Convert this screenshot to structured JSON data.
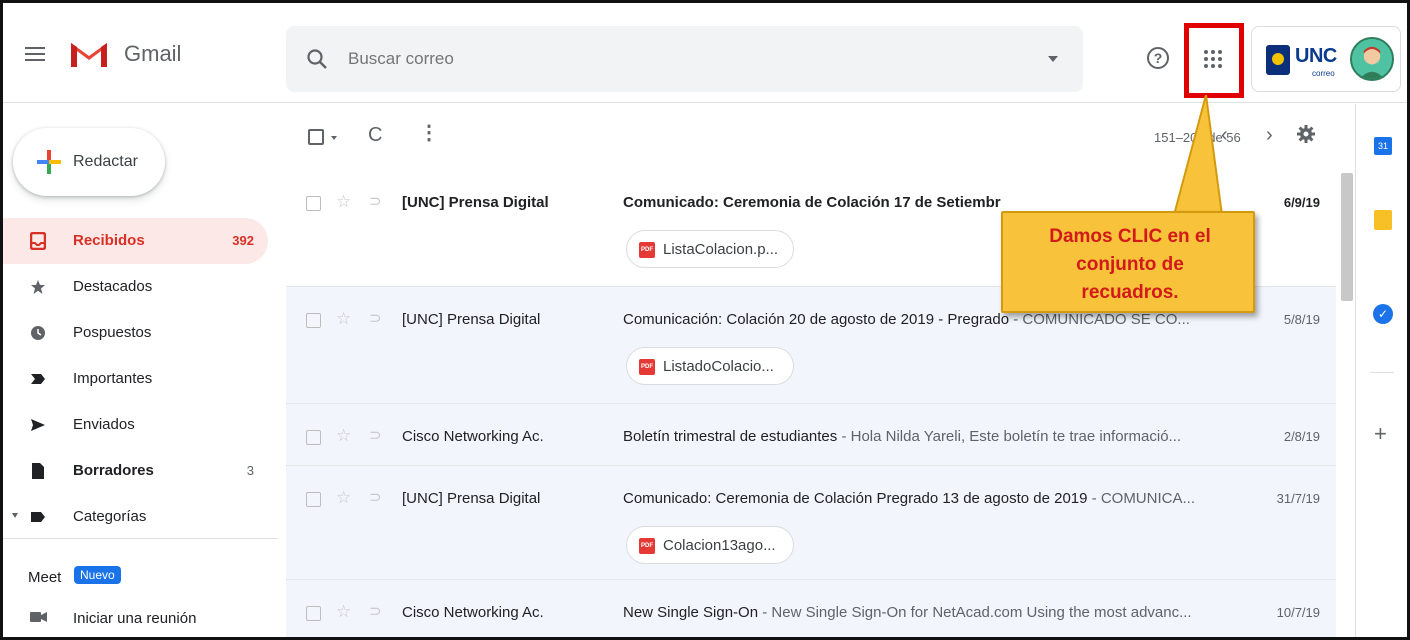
{
  "app": {
    "name": "Gmail"
  },
  "search": {
    "placeholder": "Buscar correo"
  },
  "header": {
    "help_icon": "help-icon",
    "apps_icon": "google-apps-grid-icon",
    "account_org": "UNC",
    "account_org_sub": "correo"
  },
  "compose": {
    "label": "Redactar"
  },
  "sidebar": {
    "items": [
      {
        "label": "Recibidos",
        "count": "392",
        "icon": "inbox-icon"
      },
      {
        "label": "Destacados",
        "count": "",
        "icon": "star-icon"
      },
      {
        "label": "Pospuestos",
        "count": "",
        "icon": "clock-icon"
      },
      {
        "label": "Importantes",
        "count": "",
        "icon": "important-icon"
      },
      {
        "label": "Enviados",
        "count": "",
        "icon": "send-icon"
      },
      {
        "label": "Borradores",
        "count": "3",
        "icon": "draft-icon"
      },
      {
        "label": "Categorías",
        "count": "",
        "icon": "label-icon"
      }
    ]
  },
  "meet": {
    "title": "Meet",
    "badge": "Nuevo",
    "item": "Iniciar una reunión"
  },
  "toolbar": {
    "range": "151–200 de 56",
    "refresh": "C",
    "more": "⋮",
    "prev": "‹",
    "next": "›"
  },
  "emails": [
    {
      "sender": "[UNC] Prensa Digital",
      "subject": "Comunicado: Ceremonia de Colación 17 de Setiembr",
      "snippet": "",
      "date": "6/9/19",
      "attachment": "ListaColacion.p...",
      "unread": true
    },
    {
      "sender": "[UNC] Prensa Digital",
      "subject": "Comunicación: Colación 20 de agosto de 2019 - Pregrado",
      "snippet": " - COMUNICADO SE CO...",
      "date": "5/8/19",
      "attachment": "ListadoColacio...",
      "unread": false
    },
    {
      "sender": "Cisco Networking Ac.",
      "subject": "Boletín trimestral de estudiantes",
      "snippet": " - Hola Nilda Yareli, Este boletín te trae informació...",
      "date": "2/8/19",
      "attachment": "",
      "unread": false
    },
    {
      "sender": "[UNC] Prensa Digital",
      "subject": "Comunicado: Ceremonia de Colación Pregrado 13 de agosto de 2019",
      "snippet": " - COMUNICA...",
      "date": "31/7/19",
      "attachment": "Colacion13ago...",
      "unread": false
    },
    {
      "sender": "Cisco Networking Ac.",
      "subject": "New Single Sign-On",
      "snippet": " - New Single Sign-On for NetAcad.com Using the most advanc...",
      "date": "10/7/19",
      "attachment": "",
      "unread": false
    }
  ],
  "callout": {
    "lines": [
      "Damos CLIC en el",
      "conjunto de",
      "recuadros."
    ]
  },
  "side_panel": {
    "calendar_label": "31",
    "add": "+"
  },
  "colors": {
    "highlight": "#e00000",
    "callout_bg": "#f8c23a",
    "callout_text": "#d21a1a",
    "inbox_active": "#d93025"
  }
}
